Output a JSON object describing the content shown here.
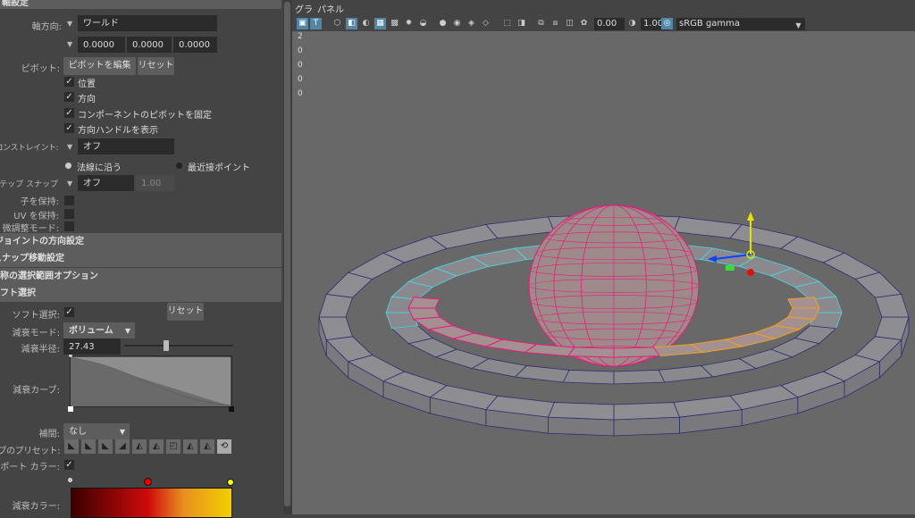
{
  "panel": {
    "header_label": "軸設定",
    "axis_dir_label": "軸方向:",
    "axis_dir_value": "ワールド",
    "xyz": [
      "0.0000",
      "0.0000",
      "0.0000"
    ],
    "pivot_label": "ピボット:",
    "edit_pivot_btn": "ピボットを編集",
    "reset_btn": "リセット",
    "checks": [
      {
        "label": "位置",
        "checked": true
      },
      {
        "label": "方向",
        "checked": true
      },
      {
        "label": "コンポーネントのピボットを固定",
        "checked": true
      },
      {
        "label": "方向ハンドルを表示",
        "checked": true
      }
    ],
    "constraint_label": "フォーム コンストレイント:",
    "constraint_value": "オフ",
    "radio_normal": "法線に沿う",
    "radio_nearest": "最近接ポイント",
    "step_snap_label": "ステップ スナップ",
    "step_snap_value": "オフ",
    "step_snap_num": "1.00",
    "preserve_children": "子を保持:",
    "preserve_uv": "UV を保持:",
    "tweak_mode": "微調整モード:",
    "sections": [
      "ジョイントの方向設定",
      "スナップ移動設定",
      "対称の選択範囲オプション",
      "ソフト選択"
    ],
    "soft_select_label": "ソフト選択:",
    "soft_reset": "リセット",
    "falloff_mode_label": "減衰モード:",
    "falloff_mode_value": "ボリューム",
    "falloff_radius_label": "減衰半径:",
    "falloff_radius_value": "27.43",
    "falloff_radius_fraction": 0.28,
    "falloff_curve_label": "減衰カーブ:",
    "interp_label": "補間:",
    "interp_value": "なし",
    "presets_label": "カーブのプリセット:",
    "viewport_color_label": "ビューポート カラー:",
    "falloff_color_label": "減衰カラー:"
  },
  "viewport": {
    "menu": [
      "グラ",
      "パネル"
    ],
    "exposure": "0.00",
    "gamma": "1.00",
    "colorspace": "sRGB gamma",
    "hud": [
      "2",
      "0",
      "0",
      "0",
      "0"
    ],
    "colors": {
      "ring_fill": "#8e8e92",
      "ring_edge": "#2d2d6e",
      "selected_edge": "#e8197a",
      "soft_edge": "#f0a020",
      "cyan_edge": "#4ad8e8"
    }
  }
}
